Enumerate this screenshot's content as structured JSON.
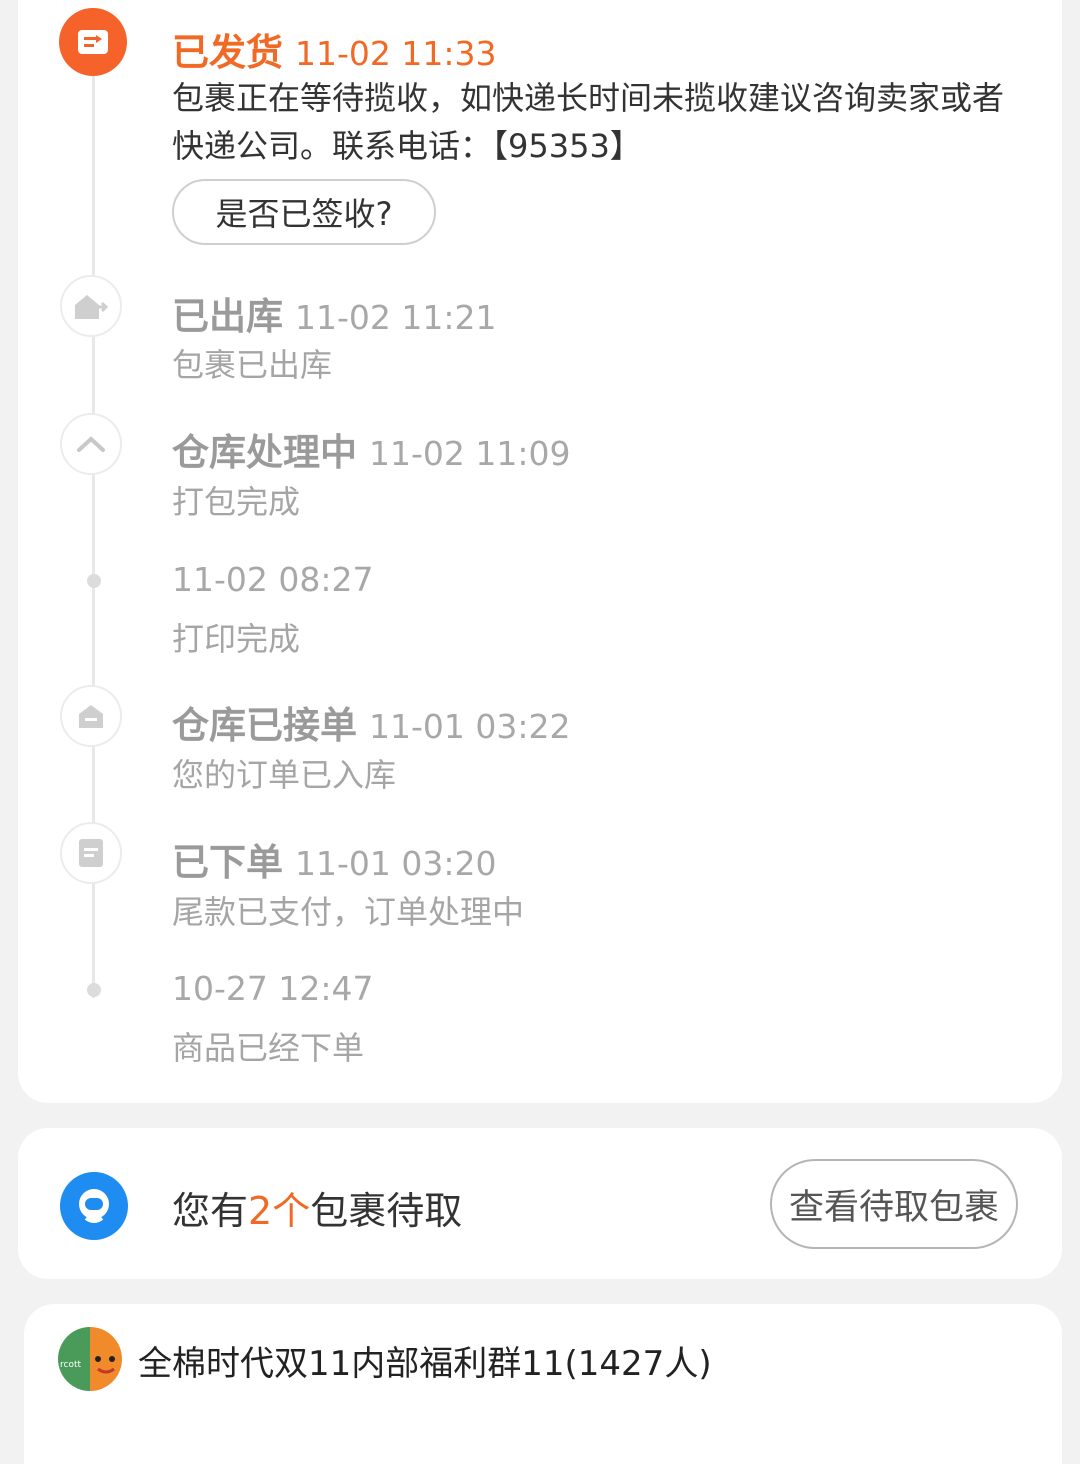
{
  "timeline": [
    {
      "status": "已发货",
      "time": "11-02 11:33",
      "desc": "包裹正在等待揽收，如快递长时间未揽收建议咨询卖家或者快递公司。联系电话：【95353】",
      "icon": "shipped-truck-icon",
      "active": true
    },
    {
      "status": "已出库",
      "time": "11-02 11:21",
      "desc": "包裹已出库",
      "icon": "warehouse-out-icon"
    },
    {
      "status": "仓库处理中",
      "time": "11-02 11:09",
      "desc": "打包完成",
      "icon": "chevron-up-icon"
    },
    {
      "status": "",
      "time": "11-02 08:27",
      "desc": "打印完成",
      "icon": "dot"
    },
    {
      "status": "仓库已接单",
      "time": "11-01 03:22",
      "desc": "您的订单已入库",
      "icon": "warehouse-icon"
    },
    {
      "status": "已下单",
      "time": "11-01 03:20",
      "desc": "尾款已支付，订单处理中",
      "icon": "order-document-icon"
    },
    {
      "status": "",
      "time": "10-27 12:47",
      "desc": "商品已经下单",
      "icon": "dot"
    }
  ],
  "sign_button": "是否已签收?",
  "pickup": {
    "prefix": "您有",
    "count": "2个",
    "suffix": "包裹待取",
    "button": "查看待取包裹",
    "icon": "courier-station-icon"
  },
  "group": {
    "name": "全棉时代双11内部福利群11(1427人)",
    "avatar_text": "rcotton 棉时代"
  },
  "colors": {
    "accent": "#f06a25",
    "pickup_blue": "#1e8cf0",
    "muted": "#a5a5a5"
  }
}
